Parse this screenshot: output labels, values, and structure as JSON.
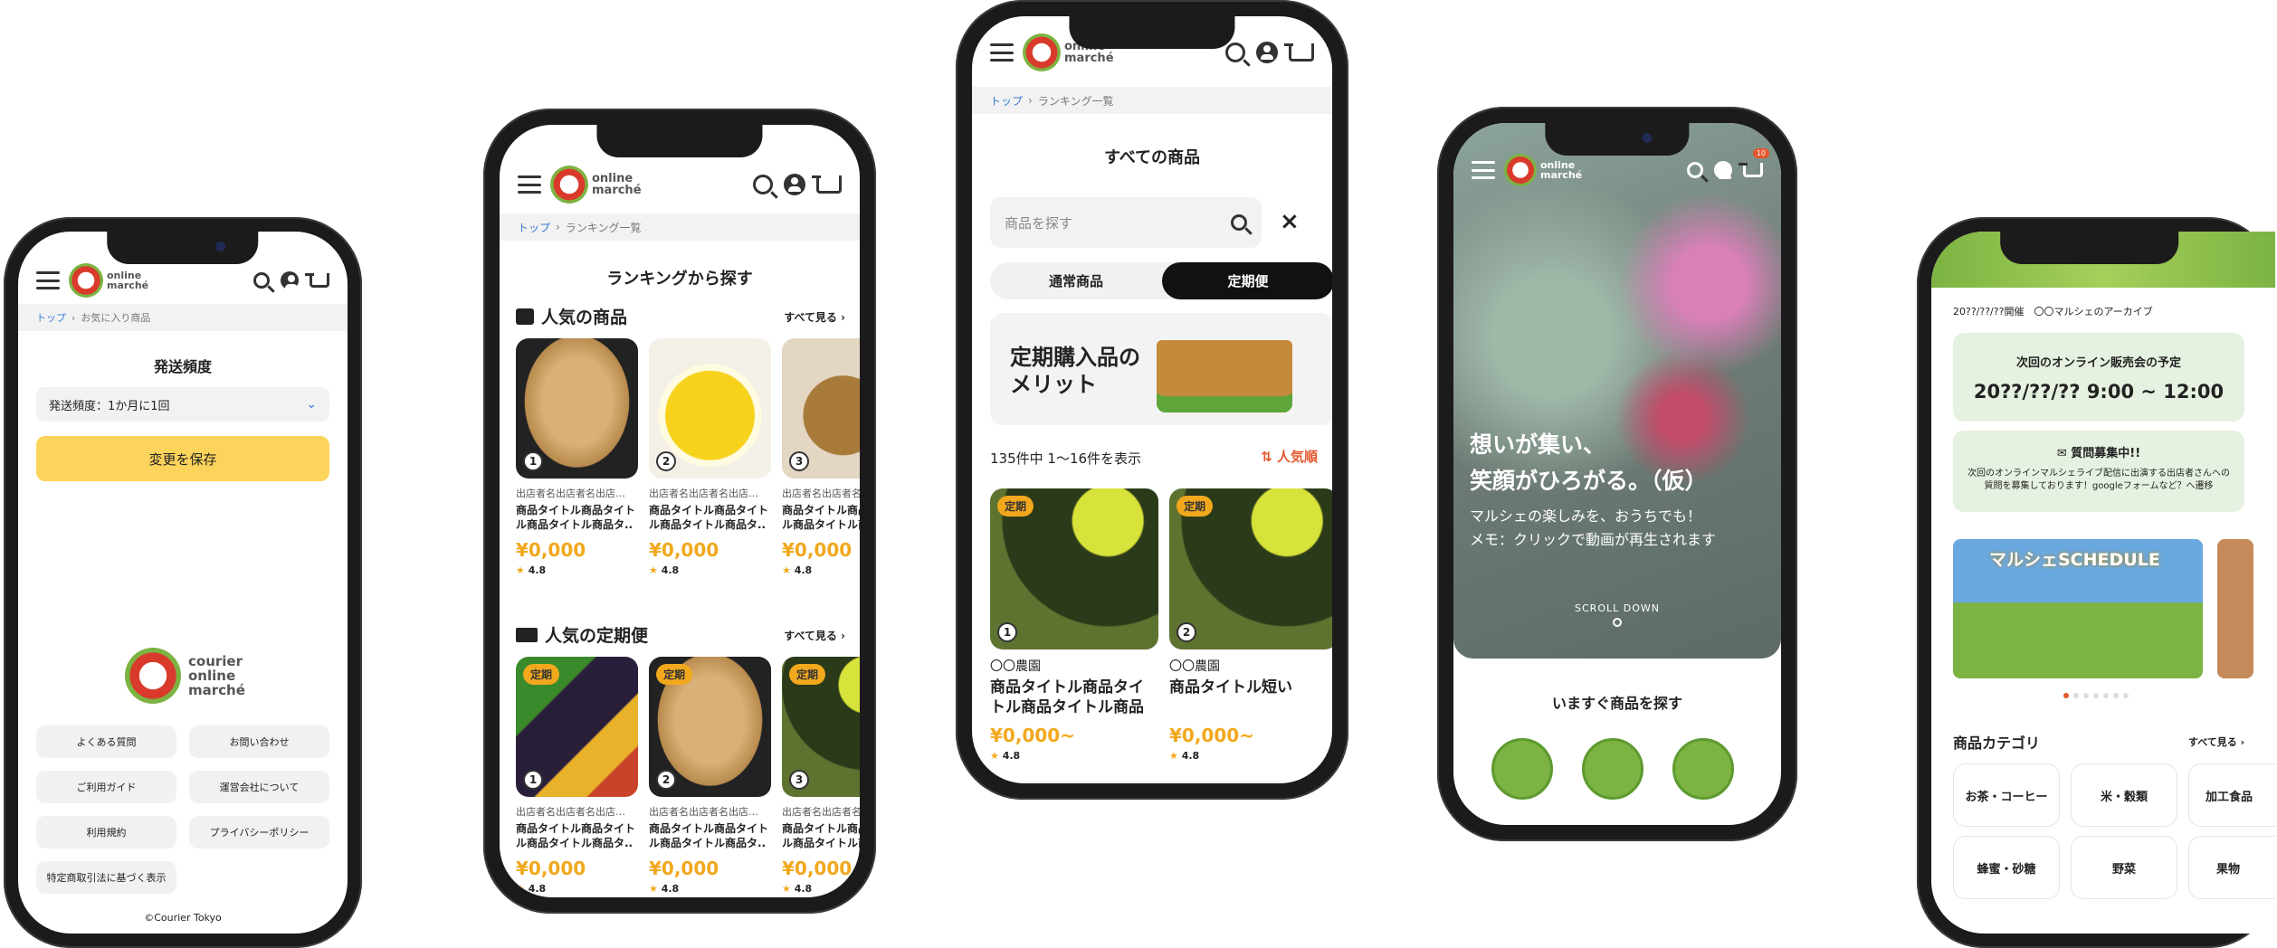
{
  "logo": {
    "line1": "online",
    "line2": "marché"
  },
  "footer_logo": {
    "line1": "courier",
    "line2": "online",
    "line3": "marché"
  },
  "p1": {
    "breadcrumb": {
      "home": "トップ",
      "current": "お気に入り商品"
    },
    "title": "発送頻度",
    "select_value": "発送頻度：1か月に1回",
    "save_label": "変更を保存",
    "footer_links": [
      "よくある質問",
      "お問い合わせ",
      "ご利用ガイド",
      "運営会社について",
      "利用規約",
      "プライバシーポリシー",
      "特定商取引法に基づく表示"
    ],
    "copyright": "©Courier Tokyo"
  },
  "p2": {
    "breadcrumb": {
      "home": "トップ",
      "current": "ランキング一覧"
    },
    "title": "ランキングから探す",
    "section1": {
      "title": "人気の商品",
      "see_all": "すべて見る"
    },
    "section2": {
      "title": "人気の定期便",
      "see_all": "すべて見る"
    },
    "shop": "出店者名出店者名出店…",
    "name": "商品タイトル商品タイトル商品タイトル商品タ..",
    "price": "¥0,000",
    "rating": "4.8",
    "tag": "定期",
    "ranks": [
      "1",
      "2",
      "3"
    ]
  },
  "p3": {
    "breadcrumb": {
      "home": "トップ",
      "current": "ランキング一覧"
    },
    "title": "すべての商品",
    "search_placeholder": "商品を探す",
    "tab_normal": "通常商品",
    "tab_subscription": "定期便",
    "banner_text": "定期購入品の\nメリット",
    "result_count": "135件中 1〜16件を表示",
    "sort_label": "人気順",
    "products": [
      {
        "tag": "定期",
        "rank": "1",
        "shop": "〇〇農園",
        "name": "商品タイトル商品タイトル商品タイトル商品タ..",
        "price": "¥0,000~",
        "rating": "4.8"
      },
      {
        "tag": "定期",
        "rank": "2",
        "shop": "〇〇農園",
        "name": "商品タイトル短い",
        "price": "¥0,000~",
        "rating": "4.8"
      }
    ]
  },
  "p4": {
    "hero_line1": "想いが集い、",
    "hero_line2": "笑顔がひろがる。（仮）",
    "hero_sub1": "マルシェの楽しみを、おうちでも！",
    "hero_sub2": "メモ：クリックで動画が再生されます",
    "scroll": "SCROLL DOWN",
    "section": "いますぐ商品を探す",
    "cart_badge": "10"
  },
  "p5": {
    "archive_date": "20??/??/??開催",
    "archive_label": "〇〇マルシェのアーカイブ",
    "next_title": "次回のオンライン販売会の予定",
    "next_datetime": "20??/??/?? 9:00 ~ 12:00",
    "question_title": "質問募集中!!",
    "question_body": "次回のオンラインマルシェライブ配信に出演する出店者さんへの質問を募集しております！googleフォームなど？へ遷移",
    "schedule_label": "マルシェSCHEDULE",
    "category_title": "商品カテゴリ",
    "category_see_all": "すべて見る",
    "categories": [
      "お茶・コーヒー",
      "米・穀類",
      "加工食品",
      "蜂蜜・砂糖",
      "野菜",
      "果物"
    ]
  }
}
